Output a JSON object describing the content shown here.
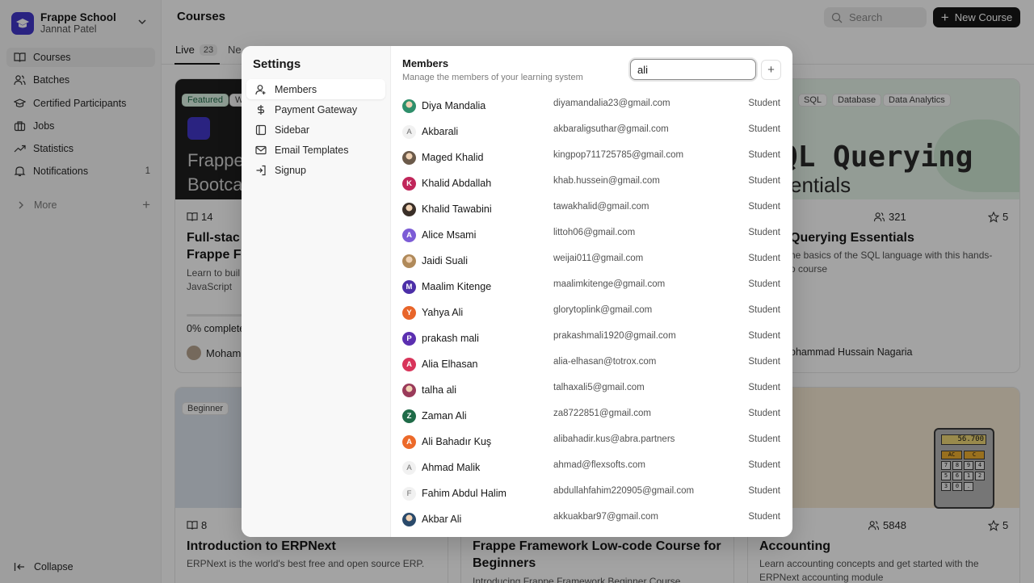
{
  "brand": {
    "name": "Frappe School",
    "user": "Jannat Patel"
  },
  "sidebar": {
    "items": [
      {
        "label": "Courses"
      },
      {
        "label": "Batches"
      },
      {
        "label": "Certified Participants"
      },
      {
        "label": "Jobs"
      },
      {
        "label": "Statistics"
      },
      {
        "label": "Notifications",
        "count": "1"
      }
    ],
    "more_label": "More",
    "collapse_label": "Collapse"
  },
  "header": {
    "title": "Courses",
    "search_placeholder": "Search",
    "new_course_label": "New Course"
  },
  "tabs": [
    {
      "label": "Live",
      "count": "23"
    },
    {
      "label": "Ne"
    }
  ],
  "cards": {
    "c1": {
      "tag1": "Featured",
      "tag2": "W",
      "cover_text1": "Frappe",
      "cover_text2": "Bootca",
      "lessons": "14",
      "title1": "Full-stac",
      "title2": "Frappe F",
      "desc1": "Learn to buil",
      "desc2": "JavaScript",
      "progress": "0% complete",
      "progress_value": 0,
      "author": "Moham"
    },
    "c2": {
      "tag1": "SQL",
      "tag2": "Database",
      "tag3": "Data Analytics",
      "cover_text1": "QL Querying",
      "cover_text2": "entials",
      "students": "321",
      "rating": "5",
      "title": "Querying Essentials",
      "desc1": "he basics of the SQL language with this hands-",
      "desc2": "o course",
      "author": "ohammad Hussain Nagaria"
    },
    "c3": {
      "tag1": "Beginner",
      "lessons": "8",
      "title": "Introduction to ERPNext",
      "desc": "ERPNext is the world's best free and open source ERP."
    },
    "c4": {
      "title1": "Frappe Framework Low-code Course for",
      "title2": "Beginners",
      "desc": "Introducing Frappe Framework Beginner Course"
    },
    "c5": {
      "calc_display": "56.700",
      "calc_keys": [
        "AC",
        "C",
        "7",
        "8",
        "9",
        "4",
        "5",
        "6",
        "1",
        "2",
        "3",
        "0",
        "."
      ],
      "students": "5848",
      "rating": "5",
      "title": "Accounting",
      "desc1": "Learn accounting concepts and get started with the",
      "desc2": "ERPNext accounting module"
    }
  },
  "settings": {
    "title": "Settings",
    "menu": [
      {
        "label": "Members",
        "icon": "user-icon"
      },
      {
        "label": "Payment Gateway",
        "icon": "dollar-icon"
      },
      {
        "label": "Sidebar",
        "icon": "sidebar-icon"
      },
      {
        "label": "Email Templates",
        "icon": "mail-icon"
      },
      {
        "label": "Signup",
        "icon": "login-icon"
      }
    ]
  },
  "members": {
    "title": "Members",
    "subtitle": "Manage the members of your learning system",
    "search_value": "ali",
    "add_label": "+",
    "list": [
      {
        "name": "Diya Mandalia",
        "email": "diyamandalia23@gmail.com",
        "role": "Student",
        "initial": "",
        "color": "#2f8f6b",
        "photo": true
      },
      {
        "name": "Akbarali",
        "email": "akbaraligsuthar@gmail.com",
        "role": "Student",
        "initial": "A",
        "color": "",
        "photo": false
      },
      {
        "name": "Maged Khalid",
        "email": "kingpop711725785@gmail.com",
        "role": "Student",
        "initial": "",
        "color": "#6b5a4a",
        "photo": true
      },
      {
        "name": "Khalid Abdallah",
        "email": "khab.hussein@gmail.com",
        "role": "Student",
        "initial": "K",
        "color": "#c0265a",
        "photo": false
      },
      {
        "name": "Khalid Tawabini",
        "email": "tawakhalid@gmail.com",
        "role": "Student",
        "initial": "",
        "color": "#3a2f28",
        "photo": true
      },
      {
        "name": "Alice Msami",
        "email": "littoh06@gmail.com",
        "role": "Student",
        "initial": "A",
        "color": "#7c5cd6",
        "photo": false
      },
      {
        "name": "Jaidi Suali",
        "email": "weijai011@gmail.com",
        "role": "Student",
        "initial": "",
        "color": "#b08a5a",
        "photo": true
      },
      {
        "name": "Maalim Kitenge",
        "email": "maalimkitenge@gmail.com",
        "role": "Student",
        "initial": "M",
        "color": "#4c2fa8",
        "photo": false
      },
      {
        "name": "Yahya Ali",
        "email": "glorytoplink@gmail.com",
        "role": "Student",
        "initial": "Y",
        "color": "#e8652a",
        "photo": false
      },
      {
        "name": "prakash mali",
        "email": "prakashmali1920@gmail.com",
        "role": "Student",
        "initial": "P",
        "color": "#5b2fb0",
        "photo": false
      },
      {
        "name": "Alia Elhasan",
        "email": "alia-elhasan@totrox.com",
        "role": "Student",
        "initial": "A",
        "color": "#d8345a",
        "photo": false
      },
      {
        "name": "talha ali",
        "email": "talhaxali5@gmail.com",
        "role": "Student",
        "initial": "",
        "color": "#9a3a5a",
        "photo": true
      },
      {
        "name": "Zaman Ali",
        "email": "za8722851@gmail.com",
        "role": "Student",
        "initial": "Z",
        "color": "#1f6b48",
        "photo": false
      },
      {
        "name": "Ali Bahadır Kuş",
        "email": "alibahadir.kus@abra.partners",
        "role": "Student",
        "initial": "A",
        "color": "#ec6a2a",
        "photo": false
      },
      {
        "name": "Ahmad Malik",
        "email": "ahmad@flexsofts.com",
        "role": "Student",
        "initial": "A",
        "color": "",
        "photo": false
      },
      {
        "name": "Fahim Abdul Halim",
        "email": "abdullahfahim220905@gmail.com",
        "role": "Student",
        "initial": "F",
        "color": "",
        "photo": false
      },
      {
        "name": "Akbar Ali",
        "email": "akkuakbar97@gmail.com",
        "role": "Student",
        "initial": "",
        "color": "#2a4a6b",
        "photo": true
      }
    ]
  }
}
